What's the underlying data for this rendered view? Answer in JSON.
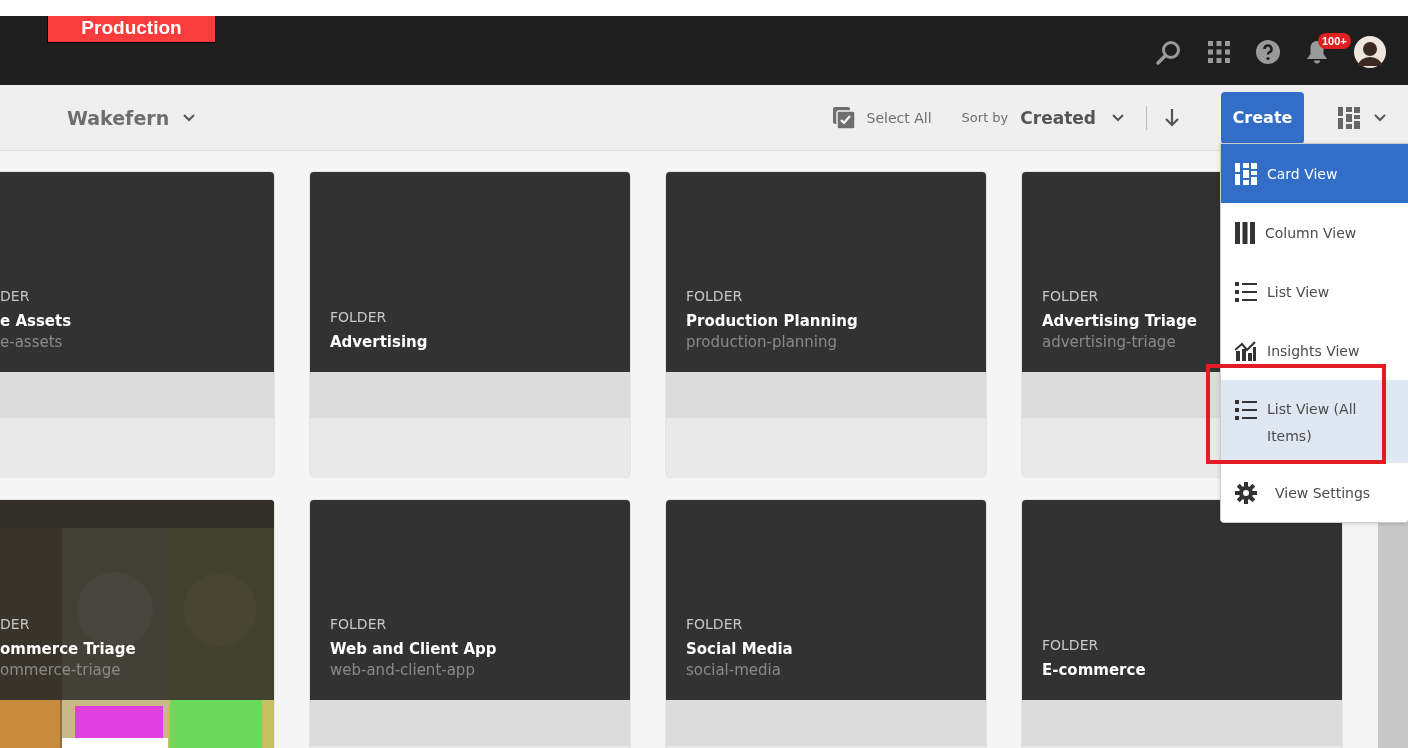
{
  "header": {
    "environment_badge": "Production",
    "notifications": {
      "count": "100+"
    }
  },
  "toolbar": {
    "title": "Wakefern",
    "select_all": "Select All",
    "sort_label": "Sort by",
    "sort_value": "Created",
    "create_button": "Create"
  },
  "view_menu": {
    "items": [
      {
        "label": "Card View",
        "kind": "cards",
        "selected": true,
        "hovered": false,
        "annotated": false
      },
      {
        "label": "Column View",
        "kind": "columns",
        "selected": false,
        "hovered": false,
        "annotated": false
      },
      {
        "label": "List View",
        "kind": "list",
        "selected": false,
        "hovered": false,
        "annotated": false
      },
      {
        "label": "Insights View",
        "kind": "insights",
        "selected": false,
        "hovered": false,
        "annotated": false
      },
      {
        "label": "List View (All Items)",
        "kind": "list",
        "selected": false,
        "hovered": true,
        "annotated": true
      },
      {
        "label": "View Settings",
        "kind": "gear",
        "selected": false,
        "hovered": false,
        "annotated": false
      }
    ]
  },
  "cards": [
    {
      "type": "DER",
      "title": "e Assets",
      "path": "e-assets"
    },
    {
      "type": "FOLDER",
      "title": "Advertising"
    },
    {
      "type": "FOLDER",
      "title": "Production Planning",
      "path": "production-planning"
    },
    {
      "type": "FOLDER",
      "title": "Advertising Triage",
      "path": "advertising-triage"
    },
    {
      "type": "DER",
      "title": "ommerce Triage",
      "path": "ommerce-triage",
      "kind": "picture"
    },
    {
      "type": "FOLDER",
      "title": "Web and Client App",
      "path": "web-and-client-app"
    },
    {
      "type": "FOLDER",
      "title": "Social Media",
      "path": "social-media"
    },
    {
      "type": "FOLDER",
      "title": "E-commerce"
    }
  ]
}
